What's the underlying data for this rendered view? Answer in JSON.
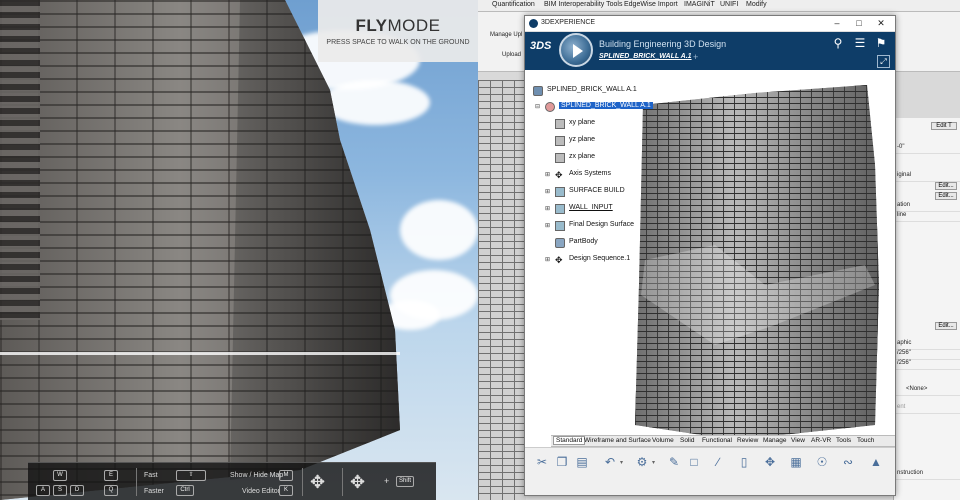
{
  "viewport": {
    "flymode_title_bold": "FLY",
    "flymode_title_thin": "MODE",
    "flymode_hint": "PRESS SPACE TO WALK ON THE GROUND",
    "hud": {
      "keys_wasd": [
        "W",
        "A",
        "S",
        "D"
      ],
      "keys_qe": [
        "E",
        "Q"
      ],
      "fast_label": "Fast",
      "faster_label": "Faster",
      "ctrl_key": "Ctrl",
      "show_hide_map_label": "Show / Hide Map",
      "video_editor_label": "Video Editor",
      "map_key": "M",
      "video_key": "K",
      "plus": "+",
      "shift_key": "Shift"
    }
  },
  "revit": {
    "ribbon_tabs": [
      "Quantification",
      "BIM Interoperability Tools",
      "EdgeWise Import",
      "IMAGINiT",
      "UNIFI",
      "Modify"
    ],
    "ribbon_mini": [
      "Manage Upl",
      "Upload"
    ],
    "properties": {
      "edit_type_label": "Edit T",
      "rows": [
        "-0\"",
        "iginal",
        "Edit...",
        "Edit...",
        "ation",
        "line",
        "Edit...",
        "aphic",
        "/256\"",
        "/256\"",
        "<None>",
        "ent",
        "nstruction"
      ]
    }
  },
  "xwin": {
    "title": "3DEXPERIENCE",
    "brand": "Building Engineering 3D Design",
    "tab_name": "SPLINED_BRICK_WALL A.1",
    "ds_logo": "3DS",
    "tree": [
      {
        "label": "SPLINED_BRICK_WALL A.1",
        "selected": false,
        "level": 0
      },
      {
        "label": "SPLINED_BRICK_WALL A.1",
        "selected": true,
        "level": 1
      },
      {
        "label": "xy plane",
        "selected": false,
        "level": 2
      },
      {
        "label": "yz plane",
        "selected": false,
        "level": 2
      },
      {
        "label": "zx plane",
        "selected": false,
        "level": 2
      },
      {
        "label": "Axis Systems",
        "selected": false,
        "level": 2
      },
      {
        "label": "SURFACE BUILD",
        "selected": false,
        "level": 2
      },
      {
        "label": "WALL_INPUT",
        "selected": false,
        "level": 2
      },
      {
        "label": "Final Design Surface",
        "selected": false,
        "level": 2
      },
      {
        "label": "PartBody",
        "selected": false,
        "level": 2
      },
      {
        "label": "Design Sequence.1",
        "selected": false,
        "level": 2
      }
    ],
    "tabs": [
      "Standard",
      "Wireframe and Surface",
      "Volume",
      "Solid",
      "Functional",
      "Review",
      "Manage",
      "View",
      "AR-VR",
      "Tools",
      "Touch"
    ],
    "active_tab": "Standard",
    "accent": "#0e3d68"
  }
}
